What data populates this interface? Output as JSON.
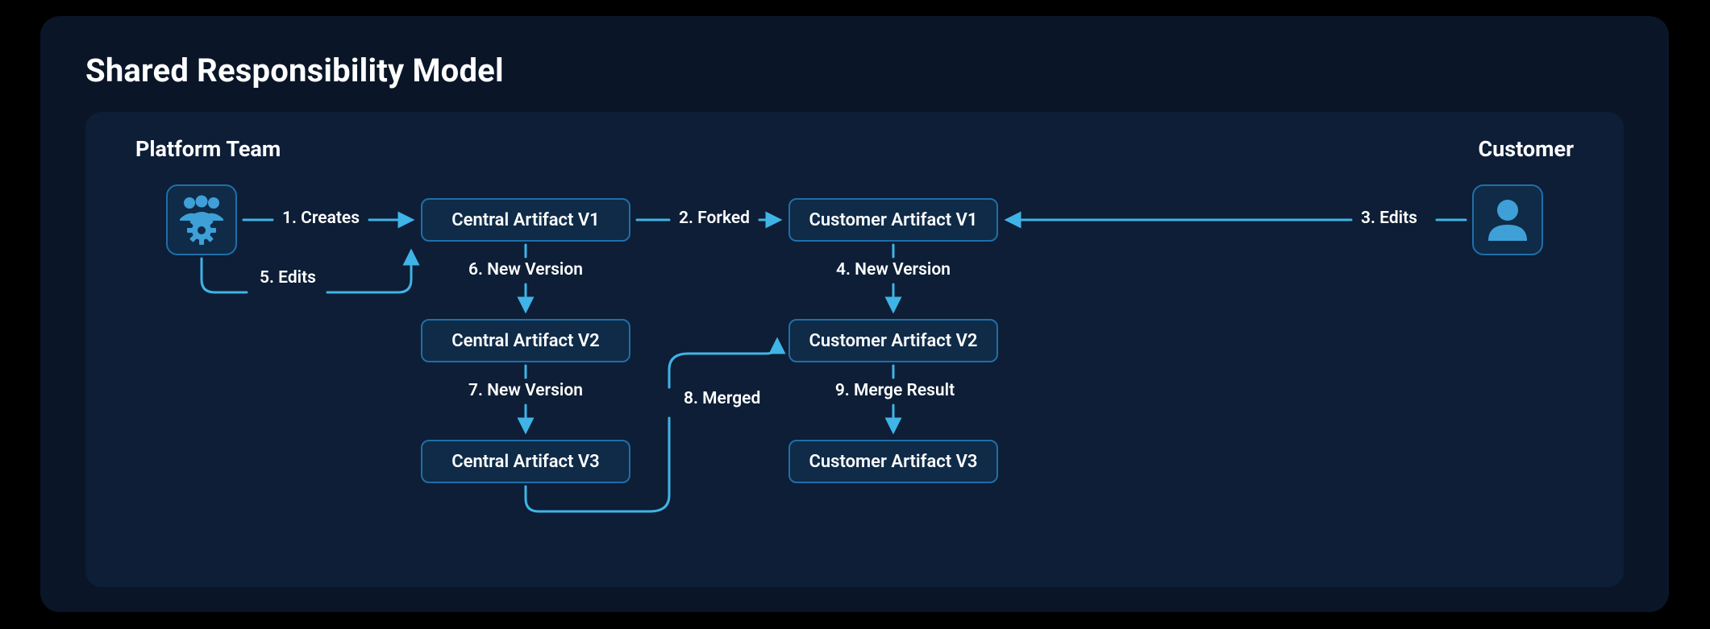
{
  "title": "Shared Responsibility Model",
  "sections": {
    "left": "Platform Team",
    "right": "Customer"
  },
  "artifacts": {
    "central_v1": "Central Artifact V1",
    "central_v2": "Central Artifact V2",
    "central_v3": "Central Artifact V3",
    "customer_v1": "Customer Artifact V1",
    "customer_v2": "Customer Artifact V2",
    "customer_v3": "Customer Artifact V3"
  },
  "edges": {
    "e1": "1. Creates",
    "e2": "2. Forked",
    "e3": "3. Edits",
    "e4": "4. New Version",
    "e5": "5. Edits",
    "e6": "6. New Version",
    "e7": "7. New Version",
    "e8": "8. Merged",
    "e9": "9. Merge Result"
  },
  "colors": {
    "bg_outer": "#0a1628",
    "bg_inner": "#0d1e36",
    "box_fill": "#0f2b48",
    "box_border": "#1f6fa8",
    "arrow": "#3fb4e6"
  }
}
